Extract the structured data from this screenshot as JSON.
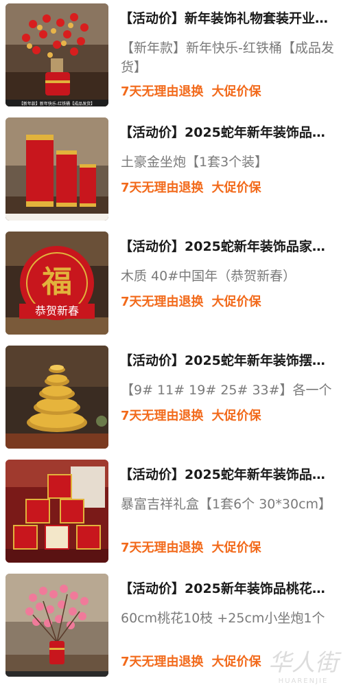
{
  "products": [
    {
      "title": "【活动价】新年装饰礼物套装开业…",
      "spec": "【新年款】新年快乐-红铁桶【成品发货】",
      "tag_return": "7天无理由退换",
      "tag_price": "大促价保",
      "image_caption": "【新年款】新年快乐-红铁桶【成品发货】"
    },
    {
      "title": "【活动价】2025蛇年新年装饰品…",
      "spec": "土豪金坐炮【1套3个装】",
      "tag_return": "7天无理由退换",
      "tag_price": "大促价保"
    },
    {
      "title": "【活动价】2025蛇新年装饰品家…",
      "spec": "木质 40#中国年（恭贺新春）",
      "tag_return": "7天无理由退换",
      "tag_price": "大促价保",
      "image_text": "福",
      "image_text2": "恭贺新春"
    },
    {
      "title": "【活动价】2025蛇年新年装饰摆…",
      "spec": "【9# 11# 19# 25# 33#】各一个",
      "tag_return": "7天无理由退换",
      "tag_price": "大促价保"
    },
    {
      "title": "【活动价】2025蛇年新年装饰品…",
      "spec": "暴富吉祥礼盒【1套6个 30*30cm】",
      "tag_return": "7天无理由退换",
      "tag_price": "大促价保"
    },
    {
      "title": "【活动价】2025新年装饰品桃花…",
      "spec": "60cm桃花10枝 +25cm小坐炮1个",
      "tag_return": "7天无理由退换",
      "tag_price": "大促价保"
    }
  ],
  "watermark": {
    "chars": "华人街",
    "latin": "HUARENJIE"
  },
  "colors": {
    "title": "#1a1a1a",
    "spec": "#7a7a7a",
    "tag": "#f26a1b",
    "festive_red": "#c8161d",
    "gold": "#e2b33c"
  }
}
